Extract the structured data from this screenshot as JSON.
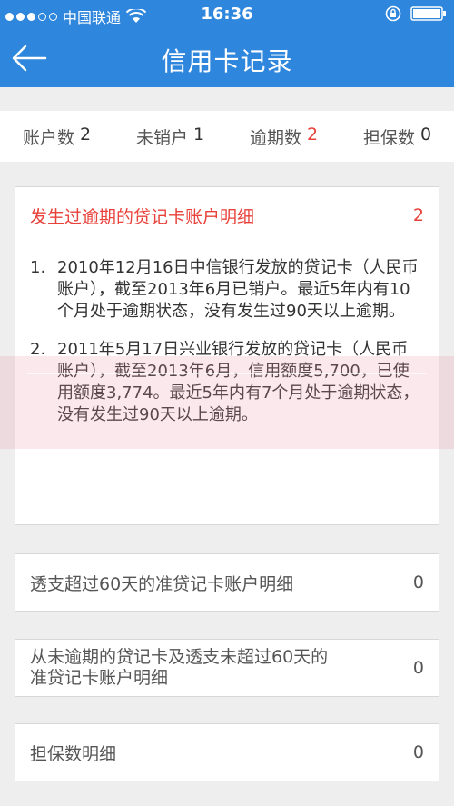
{
  "status_bar": {
    "carrier": "中国联通",
    "time": "16:36"
  },
  "nav": {
    "title": "信用卡记录"
  },
  "summary": [
    {
      "label": "账户数",
      "value": "2"
    },
    {
      "label": "未销户",
      "value": "1"
    },
    {
      "label": "逾期数",
      "value": "2"
    },
    {
      "label": "担保数",
      "value": "0"
    }
  ],
  "cards": {
    "overdue": {
      "title": "发生过逾期的贷记卡账户明细",
      "count": "2",
      "items": [
        {
          "num": "1.",
          "text": "2010年12月16日中信银行发放的贷记卡（人民币账户），截至2013年6月已销户。最近5年内有10个月处于逾期状态，没有发生过90天以上逾期。"
        },
        {
          "num": "2.",
          "text": "2011年5月17日兴业银行发放的贷记卡（人民币账户），截至2013年6月，信用额度5,700，已使用额度3,774。最近5年内有7个月处于逾期状态，没有发生过90天以上逾期。"
        }
      ]
    },
    "quasi": {
      "title": "透支超过60天的准贷记卡账户明细",
      "count": "0"
    },
    "never": {
      "title_line1": "从未逾期的贷记卡及透支未超过60天的",
      "title_line2": "准贷记卡账户明细",
      "count": "0"
    },
    "guarantee": {
      "title": "担保数明细",
      "count": "0"
    }
  },
  "colors": {
    "primary": "#2f86dd",
    "alert": "#e8423b"
  }
}
